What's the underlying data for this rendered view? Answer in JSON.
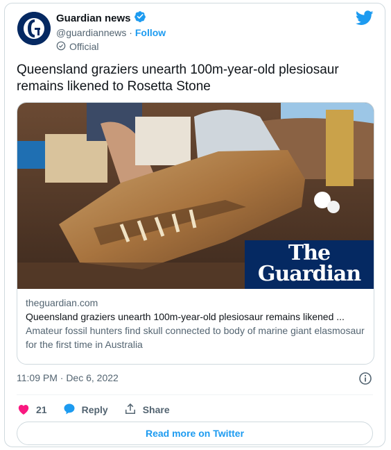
{
  "author": {
    "name": "Guardian news",
    "handle": "@guardiannews",
    "separator": " · ",
    "follow_label": "Follow",
    "official_label": "Official"
  },
  "tweet": {
    "text": "Queensland graziers unearth 100m-year-old plesiosaur remains likened to Rosetta Stone",
    "timestamp": "11:09 PM · Dec 6, 2022"
  },
  "link_card": {
    "domain": "theguardian.com",
    "title": "Queensland graziers unearth 100m-year-old plesiosaur remains likened ...",
    "description": "Amateur fossil hunters find skull connected to body of marine giant elasmosaur for the first time in Australia",
    "logo_line1": "The",
    "logo_line2": "Guardian"
  },
  "actions": {
    "like_count": "21",
    "reply_label": "Reply",
    "share_label": "Share"
  },
  "read_more_label": "Read more on Twitter",
  "colors": {
    "accent": "#1d9bf0",
    "like": "#f91880",
    "guardian_blue": "#052962",
    "text_secondary": "#536471"
  }
}
